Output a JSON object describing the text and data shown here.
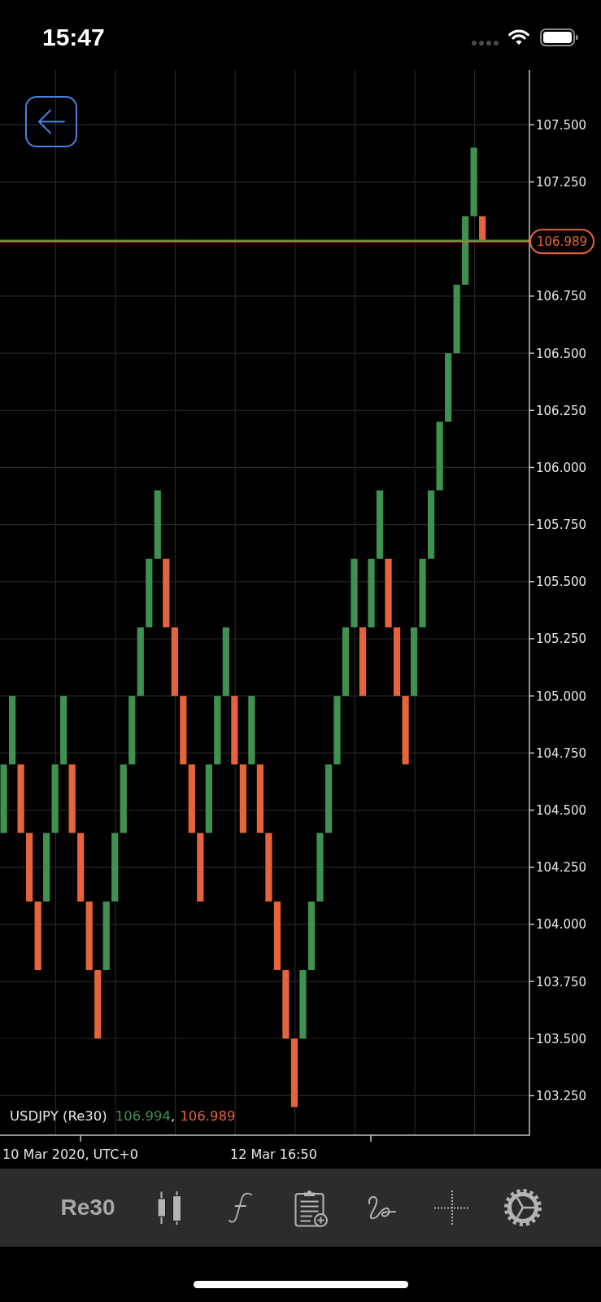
{
  "status_bar": {
    "time": "15:47"
  },
  "chart": {
    "legend": {
      "symbol": "USDJPY (Re30)",
      "prices": [
        {
          "text": "106.994",
          "color": "#3f9150"
        },
        {
          "text": "106.989",
          "color": "#e5643a"
        }
      ],
      "separator": ","
    },
    "time_labels": [
      "10 Mar 2020, UTC+0",
      "12 Mar 16:50"
    ],
    "chart_data": {
      "type": "candlestick",
      "grid": true,
      "ylim": [
        103.077,
        107.74
      ],
      "yticks": [
        {
          "value": 107.5,
          "label": "107.500"
        },
        {
          "value": 107.25,
          "label": "107.250"
        },
        {
          "value": 106.75,
          "label": "106.750"
        },
        {
          "value": 106.5,
          "label": "106.500"
        },
        {
          "value": 106.25,
          "label": "106.250"
        },
        {
          "value": 106.0,
          "label": "106.000"
        },
        {
          "value": 105.75,
          "label": "105.750"
        },
        {
          "value": 105.5,
          "label": "105.500"
        },
        {
          "value": 105.25,
          "label": "105.250"
        },
        {
          "value": 105.0,
          "label": "105.000"
        },
        {
          "value": 104.75,
          "label": "104.750"
        },
        {
          "value": 104.5,
          "label": "104.500"
        },
        {
          "value": 104.25,
          "label": "104.250"
        },
        {
          "value": 104.0,
          "label": "104.000"
        },
        {
          "value": 103.75,
          "label": "103.750"
        },
        {
          "value": 103.5,
          "label": "103.500"
        },
        {
          "value": 103.25,
          "label": "103.250"
        }
      ],
      "series": [
        {
          "color": "#3f9150",
          "ohlc": [
            [
              104.4,
              104.7,
              104.4,
              104.7
            ],
            [
              104.7,
              105.0,
              104.7,
              105.0
            ],
            null,
            null,
            null,
            [
              104.1,
              104.4,
              104.1,
              104.4
            ],
            [
              104.4,
              104.7,
              104.4,
              104.7
            ],
            [
              104.7,
              105.0,
              104.7,
              105.0
            ],
            null,
            null,
            null,
            null,
            [
              103.8,
              104.1,
              103.8,
              104.1
            ],
            [
              104.1,
              104.4,
              104.1,
              104.4
            ],
            [
              104.4,
              104.7,
              104.4,
              104.7
            ],
            [
              104.7,
              105.0,
              104.7,
              105.0
            ],
            [
              105.0,
              105.3,
              105.0,
              105.3
            ],
            [
              105.3,
              105.6,
              105.3,
              105.6
            ],
            [
              105.6,
              105.9,
              105.6,
              105.9
            ],
            null,
            null,
            null,
            null,
            null,
            [
              104.4,
              104.7,
              104.4,
              104.7
            ],
            [
              104.7,
              105.0,
              104.7,
              105.0
            ],
            [
              105.0,
              105.3,
              105.0,
              105.3
            ],
            null,
            null,
            [
              104.7,
              105.0,
              104.7,
              105.0
            ],
            null,
            null,
            null,
            null,
            null,
            [
              103.5,
              103.8,
              103.5,
              103.8
            ],
            [
              103.8,
              104.1,
              103.8,
              104.1
            ],
            [
              104.1,
              104.4,
              104.1,
              104.4
            ],
            [
              104.4,
              104.7,
              104.4,
              104.7
            ],
            [
              104.7,
              105.0,
              104.7,
              105.0
            ],
            [
              105.0,
              105.3,
              105.0,
              105.3
            ],
            [
              105.3,
              105.6,
              105.3,
              105.6
            ],
            null,
            [
              105.3,
              105.6,
              105.3,
              105.6
            ],
            [
              105.6,
              105.9,
              105.6,
              105.9
            ],
            null,
            null,
            null,
            [
              105.0,
              105.3,
              105.0,
              105.3
            ],
            [
              105.3,
              105.6,
              105.3,
              105.6
            ],
            [
              105.6,
              105.9,
              105.6,
              105.9
            ],
            [
              105.9,
              106.2,
              105.9,
              106.2
            ],
            [
              106.2,
              106.5,
              106.2,
              106.5
            ],
            [
              106.5,
              106.8,
              106.5,
              106.8
            ],
            [
              106.8,
              107.1,
              106.8,
              107.1
            ],
            [
              107.1,
              107.4,
              107.1,
              107.4
            ],
            null
          ]
        },
        {
          "color": "#e5643a",
          "ohlc": [
            null,
            null,
            [
              104.7,
              104.7,
              104.4,
              104.4
            ],
            [
              104.4,
              104.4,
              104.1,
              104.1
            ],
            [
              104.1,
              104.1,
              103.8,
              103.8
            ],
            null,
            null,
            null,
            [
              104.7,
              104.7,
              104.4,
              104.4
            ],
            [
              104.4,
              104.4,
              104.1,
              104.1
            ],
            [
              104.1,
              104.1,
              103.8,
              103.8
            ],
            [
              103.8,
              103.8,
              103.5,
              103.5
            ],
            null,
            null,
            null,
            null,
            null,
            null,
            null,
            [
              105.6,
              105.6,
              105.3,
              105.3
            ],
            [
              105.3,
              105.3,
              105.0,
              105.0
            ],
            [
              105.0,
              105.0,
              104.7,
              104.7
            ],
            [
              104.7,
              104.7,
              104.4,
              104.4
            ],
            [
              104.4,
              104.4,
              104.1,
              104.1
            ],
            null,
            null,
            null,
            [
              105.0,
              105.0,
              104.7,
              104.7
            ],
            [
              104.7,
              104.7,
              104.4,
              104.4
            ],
            null,
            [
              104.7,
              104.7,
              104.4,
              104.4
            ],
            [
              104.4,
              104.4,
              104.1,
              104.1
            ],
            [
              104.1,
              104.1,
              103.8,
              103.8
            ],
            [
              103.8,
              103.8,
              103.5,
              103.5
            ],
            [
              103.5,
              103.5,
              103.2,
              103.2
            ],
            null,
            null,
            null,
            null,
            null,
            null,
            null,
            [
              105.3,
              105.3,
              105.0,
              105.0
            ],
            null,
            null,
            [
              105.6,
              105.6,
              105.3,
              105.3
            ],
            [
              105.3,
              105.3,
              105.0,
              105.0
            ],
            [
              105.0,
              105.0,
              104.7,
              104.7
            ],
            null,
            null,
            null,
            null,
            null,
            null,
            null,
            null,
            [
              107.1,
              107.1,
              106.989,
              106.989
            ]
          ]
        }
      ],
      "ref_lines": [
        {
          "axis": "y",
          "value": 106.994,
          "color": "#3f9150"
        },
        {
          "axis": "y",
          "value": 106.989,
          "color": "#e5643a",
          "label": "106.989"
        }
      ]
    }
  },
  "toolbar": {
    "interval": "Re30"
  }
}
